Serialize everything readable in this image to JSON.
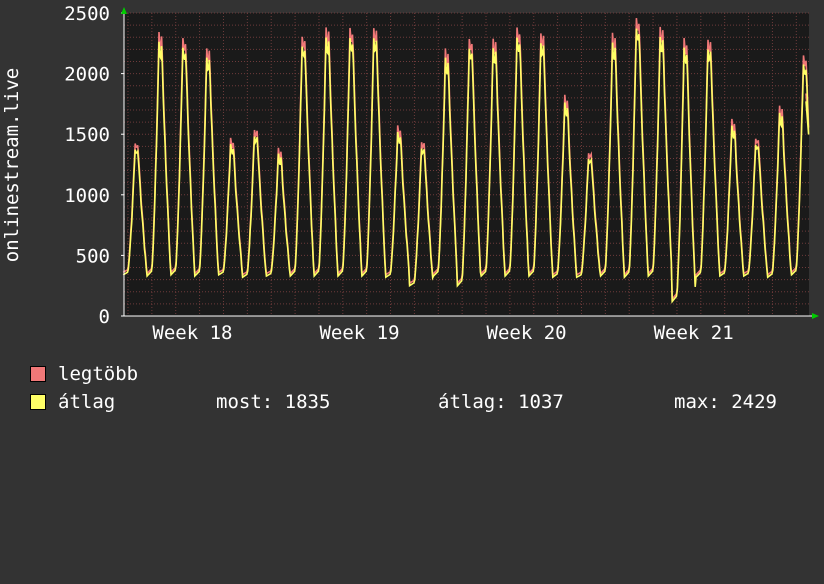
{
  "chart_data": {
    "type": "line",
    "ylabel": "onlinestream.live",
    "ylim": [
      0,
      2500
    ],
    "yticks": [
      0,
      500,
      1000,
      1500,
      2000,
      2500
    ],
    "xticks": [
      "Week 18",
      "Week 19",
      "Week 20",
      "Week 21"
    ],
    "grid": true,
    "days": 29,
    "day_peaks_max": [
      1440,
      2330,
      2300,
      2210,
      1460,
      1550,
      1370,
      2320,
      2370,
      2380,
      2380,
      1560,
      1450,
      2190,
      2300,
      2280,
      2380,
      2340,
      1810,
      1360,
      2320,
      2470,
      2380,
      2290,
      2290,
      1610,
      1480,
      1720,
      2160
    ],
    "day_troughs_avg": [
      340,
      330,
      340,
      330,
      340,
      320,
      330,
      330,
      330,
      330,
      330,
      320,
      250,
      330,
      250,
      330,
      330,
      330,
      320,
      320,
      330,
      320,
      330,
      120,
      320,
      330,
      330,
      320,
      340
    ],
    "series": [
      {
        "name": "legtöbb",
        "color": "#f07878"
      },
      {
        "name": "átlag",
        "color": "#ffff66"
      }
    ]
  },
  "legend": {
    "max_label": "legtöbb",
    "avg_label": "átlag",
    "now": "most: 1835",
    "mean": "átlag: 1037",
    "peak": "max: 2429"
  },
  "colors": {
    "background": "#333333",
    "plot_bg": "#1a1a1a",
    "grid": "#6e3b3b",
    "axis": "#ffffff",
    "max_line": "#f07878",
    "avg_line": "#ffff66"
  }
}
